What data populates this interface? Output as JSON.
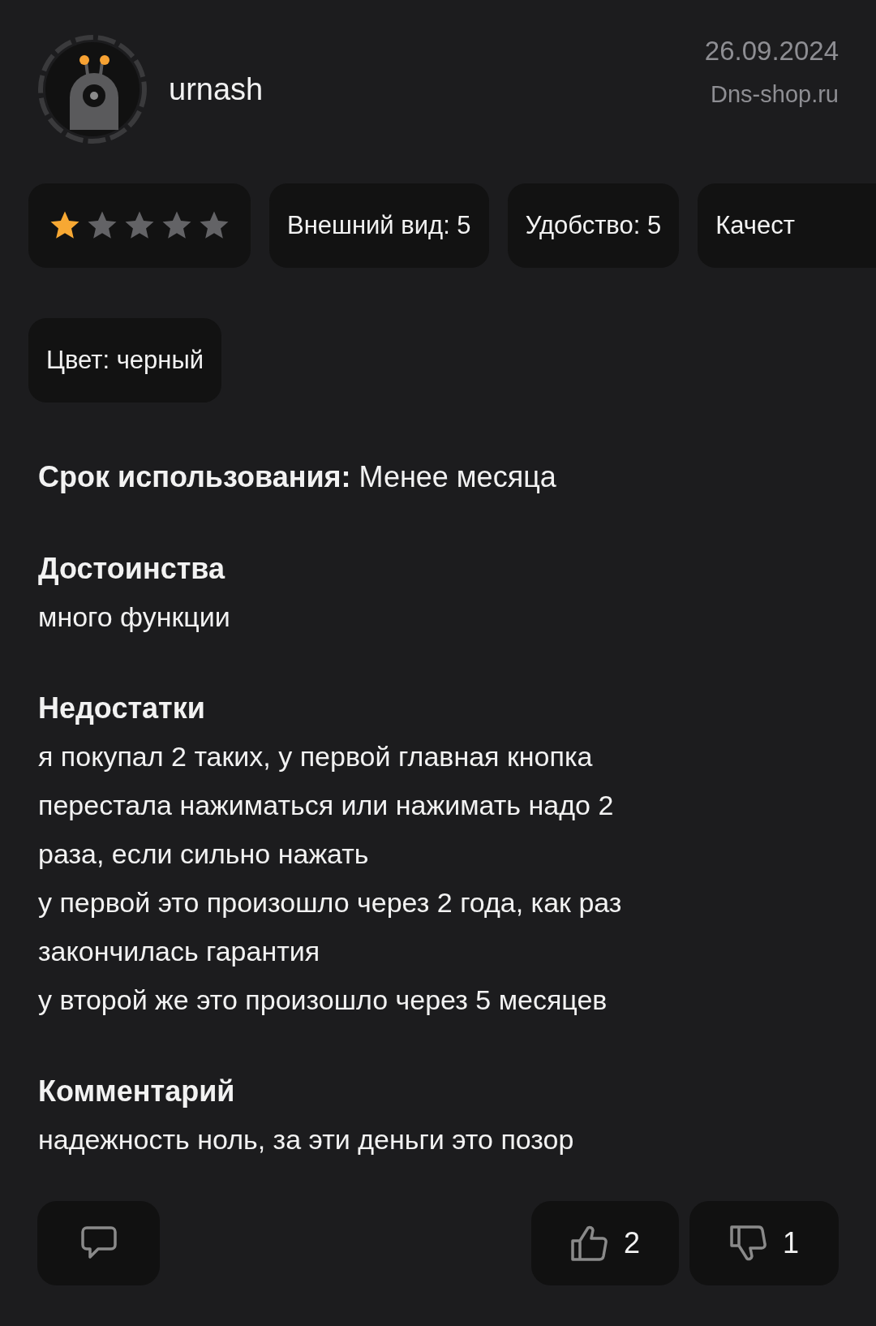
{
  "review": {
    "author": "urnash",
    "date": "26.09.2024",
    "source": "Dns-shop.ru",
    "stars": 1,
    "chip_rows": [
      [
        "Внешний вид: 5",
        "Удобство: 5",
        "Качест"
      ],
      [
        "Цвет: черный"
      ]
    ],
    "usage": {
      "label": "Срок использования:",
      "value": "Менее месяца"
    },
    "sections": [
      {
        "title": "Достоинства",
        "text": "много функции"
      },
      {
        "title": "Недостатки",
        "text": "я покупал 2 таких, у первой главная кнопка\nперестала нажиматься или нажимать надо 2\nраза, если сильно нажать\nу первой это произошло через 2 года, как раз\nзакончилась гарантия\nу второй же это произошло через 5 месяцев"
      },
      {
        "title": "Комментарий",
        "text": "надежность ноль, за эти деньги это позор"
      }
    ],
    "likes": "2",
    "dislikes": "1"
  }
}
